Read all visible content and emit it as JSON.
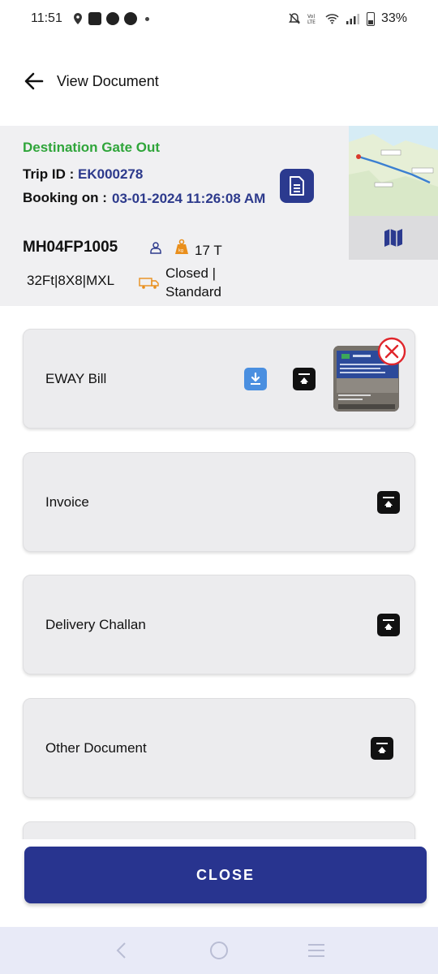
{
  "status_bar": {
    "time": "11:51",
    "battery": "33%",
    "icons": [
      "location-icon",
      "message-icon",
      "app-icon",
      "app-icon",
      "dot-icon",
      "mute-icon",
      "volte-icon",
      "wifi-icon",
      "signal-icon",
      "battery-icon"
    ]
  },
  "app_bar": {
    "title": "View Document",
    "back_icon": "arrow-left-icon"
  },
  "trip": {
    "status": "Destination Gate Out",
    "status_color": "#2fa53a",
    "trip_id_label": "Trip ID : ",
    "trip_id": "EK000278",
    "booking_label": "Booking on : ",
    "booking_value": "03-01-2024 11:26:08 AM",
    "vehicle_number": "MH04FP1005",
    "weight": "17 T",
    "vehicle_spec": "32Ft|8X8|MXL",
    "trip_status": "Closed | Standard",
    "accent_color": "#2d3a8c"
  },
  "documents": [
    {
      "label": "EWAY Bill",
      "has_file": true
    },
    {
      "label": "Invoice",
      "has_file": false
    },
    {
      "label": "Delivery Challan",
      "has_file": false
    },
    {
      "label": "Other Document",
      "has_file": false
    }
  ],
  "close_button": {
    "label": "CLOSE",
    "color": "#28348f"
  },
  "nav_bar": {
    "icons": [
      "back-nav-icon",
      "home-nav-icon",
      "recents-nav-icon"
    ]
  }
}
